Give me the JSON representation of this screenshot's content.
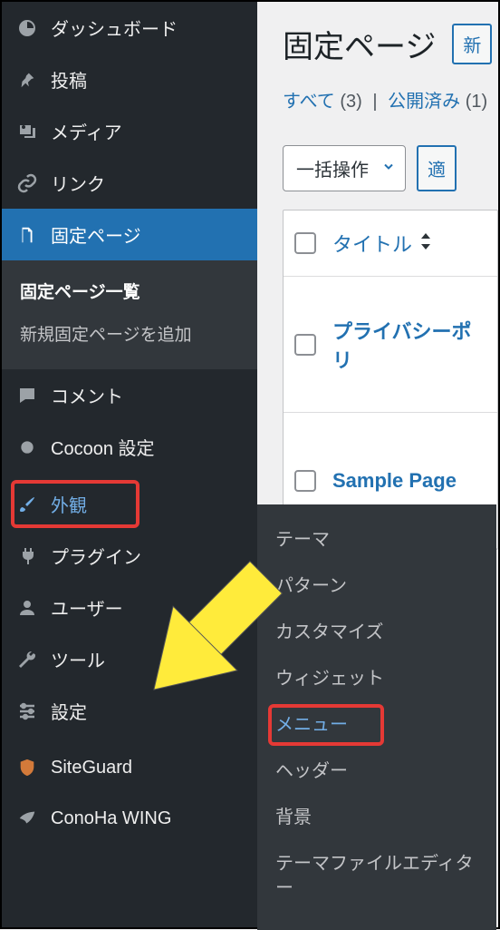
{
  "sidebar": {
    "items": [
      {
        "label": "ダッシュボード",
        "icon": "dashboard"
      },
      {
        "label": "投稿",
        "icon": "pin"
      },
      {
        "label": "メディア",
        "icon": "media"
      },
      {
        "label": "リンク",
        "icon": "link"
      },
      {
        "label": "固定ページ",
        "icon": "page"
      },
      {
        "label": "コメント",
        "icon": "comment"
      },
      {
        "label": "Cocoon 設定",
        "icon": "circle"
      },
      {
        "label": "外観",
        "icon": "brush"
      },
      {
        "label": "プラグイン",
        "icon": "plug"
      },
      {
        "label": "ユーザー",
        "icon": "user"
      },
      {
        "label": "ツール",
        "icon": "wrench"
      },
      {
        "label": "設定",
        "icon": "sliders"
      },
      {
        "label": "SiteGuard",
        "icon": "shield"
      },
      {
        "label": "ConoHa WING",
        "icon": "wing"
      }
    ],
    "pages_submenu": {
      "list": "固定ページ一覧",
      "add": "新規固定ページを追加"
    },
    "appearance_submenu": [
      "テーマ",
      "パターン",
      "カスタマイズ",
      "ウィジェット",
      "メニュー",
      "ヘッダー",
      "背景",
      "テーマファイルエディター"
    ]
  },
  "main": {
    "title": "固定ページ",
    "add_button": "新",
    "filters": {
      "all_label": "すべて",
      "all_count": "(3)",
      "published_label": "公開済み",
      "published_count": "(1)"
    },
    "bulk": {
      "select_label": "一括操作",
      "apply_label": "適"
    },
    "table": {
      "title_header": "タイトル",
      "rows": [
        {
          "title": "プライバシーポリ"
        },
        {
          "title": "Sample Page"
        }
      ]
    }
  }
}
